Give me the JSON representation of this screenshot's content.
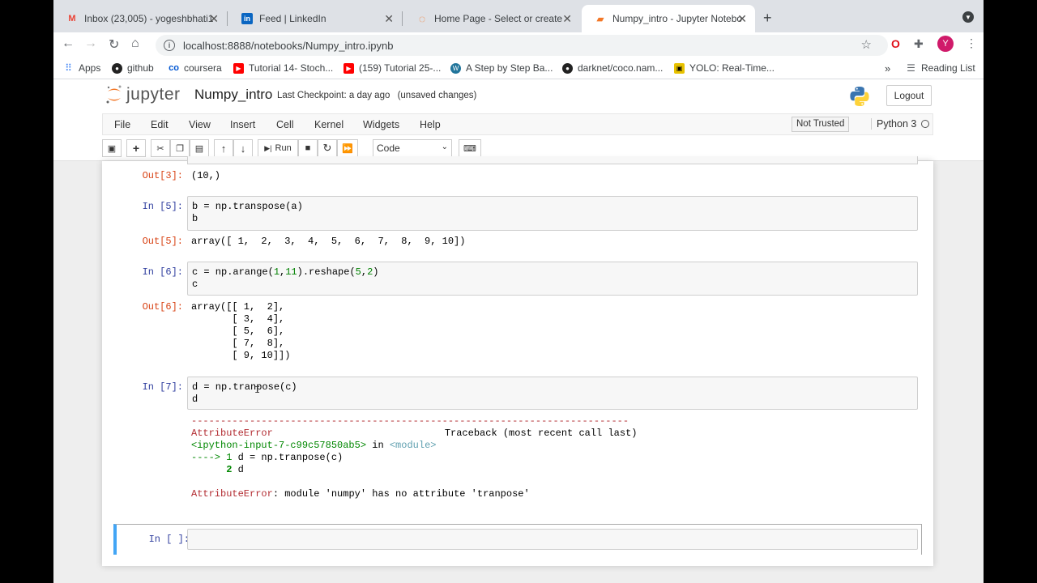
{
  "browser": {
    "tabs": [
      {
        "title": "Inbox (23,005) - yogeshbhati1",
        "icon": "gmail-icon"
      },
      {
        "title": "Feed | LinkedIn",
        "icon": "linkedin-icon"
      },
      {
        "title": "Home Page - Select or create a",
        "icon": "jupyter-icon"
      },
      {
        "title": "Numpy_intro - Jupyter Notebook",
        "icon": "jupyter-icon"
      }
    ],
    "url": "localhost:8888/notebooks/Numpy_intro.ipynb",
    "avatar_letter": "Y",
    "bookmarks": [
      {
        "label": "Apps"
      },
      {
        "label": "github"
      },
      {
        "label": "coursera"
      },
      {
        "label": "Tutorial 14- Stoch..."
      },
      {
        "label": "(159) Tutorial 25-..."
      },
      {
        "label": "A Step by Step Ba..."
      },
      {
        "label": "darknet/coco.nam..."
      },
      {
        "label": "YOLO: Real-Time..."
      }
    ],
    "more_bookmarks": "»",
    "reading_list": "Reading List"
  },
  "jupyter": {
    "logo_text": "jupyter",
    "notebook_name": "Numpy_intro",
    "checkpoint": "Last Checkpoint: a day ago",
    "unsaved": "(unsaved changes)",
    "logout": "Logout",
    "menu": [
      "File",
      "Edit",
      "View",
      "Insert",
      "Cell",
      "Kernel",
      "Widgets",
      "Help"
    ],
    "not_trusted": "Not Trusted",
    "kernel": "Python 3",
    "run_label": "Run",
    "cell_type": "Code"
  },
  "cells": {
    "out3_prompt": "Out[3]:",
    "out3_text": "(10,)",
    "in5_prompt": "In [5]:",
    "in5_line1_a": "b",
    "in5_line1_b": " = np.transpose(a)",
    "in5_line2": "b",
    "out5_prompt": "Out[5]:",
    "out5_text": "array([ 1,  2,  3,  4,  5,  6,  7,  8,  9, 10])",
    "in6_prompt": "In [6]:",
    "in6_line1_a": "c = np.arange(",
    "in6_line1_n1": "1",
    "in6_line1_c": ",",
    "in6_line1_n2": "11",
    "in6_line1_d": ").reshape(",
    "in6_line1_n3": "5",
    "in6_line1_e": ",",
    "in6_line1_n4": "2",
    "in6_line1_f": ")",
    "in6_line2": "c",
    "out6_prompt": "Out[6]:",
    "out6_lines": [
      "array([[ 1,  2],",
      "       [ 3,  4],",
      "       [ 5,  6],",
      "       [ 7,  8],",
      "       [ 9, 10]])"
    ],
    "in7_prompt": "In [7]:",
    "in7_line1": "d = np.tranpose(c)",
    "in7_line2": "d",
    "err_dashes": "---------------------------------------------------------------------------",
    "err_name": "AttributeError",
    "err_traceback": "Traceback (most recent call last)",
    "err_input": "<ipython-input-7-c99c57850ab5>",
    "err_in": " in ",
    "err_module": "<module>",
    "err_arrow": "----> 1 ",
    "err_line1": "d = np.tranpose(c)",
    "err_line2_num": "      2 ",
    "err_line2": "d",
    "err_final_name": "AttributeError",
    "err_final_msg": ": module 'numpy' has no attribute 'tranpose'",
    "empty_prompt": "In [ ]:"
  }
}
